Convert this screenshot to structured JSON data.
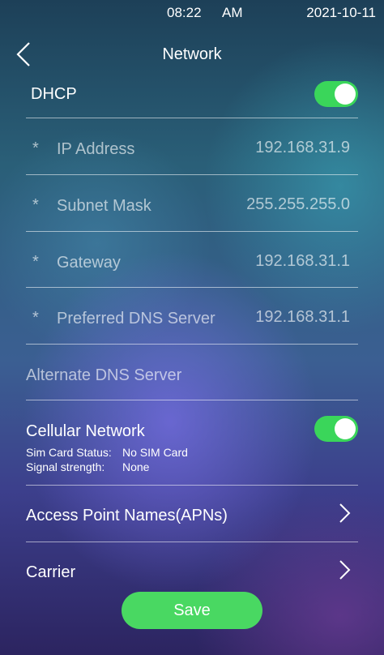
{
  "status_bar": {
    "time": "08:22",
    "ampm": "AM",
    "date": "2021-10-11"
  },
  "header": {
    "title": "Network"
  },
  "dhcp": {
    "label": "DHCP",
    "enabled": true
  },
  "fields": [
    {
      "label": "IP Address",
      "value": "192.168.31.9"
    },
    {
      "label": "Subnet Mask",
      "value": "255.255.255.0"
    },
    {
      "label": "Gateway",
      "value": "192.168.31.1"
    },
    {
      "label": "Preferred DNS Server",
      "value": "192.168.31.1"
    }
  ],
  "required_mark": "*",
  "alternate_dns": {
    "label": "Alternate DNS Server"
  },
  "cellular": {
    "label": "Cellular Network",
    "enabled": true,
    "sim_status_label": "Sim Card Status:",
    "sim_status_value": "No SIM Card",
    "signal_label": "Signal strength:",
    "signal_value": "None"
  },
  "apn": {
    "label": "Access Point Names(APNs)"
  },
  "carrier": {
    "label": "Carrier"
  },
  "save": {
    "label": "Save"
  },
  "colors": {
    "toggle_on": "#3ad65a",
    "save_button": "#49d862"
  }
}
